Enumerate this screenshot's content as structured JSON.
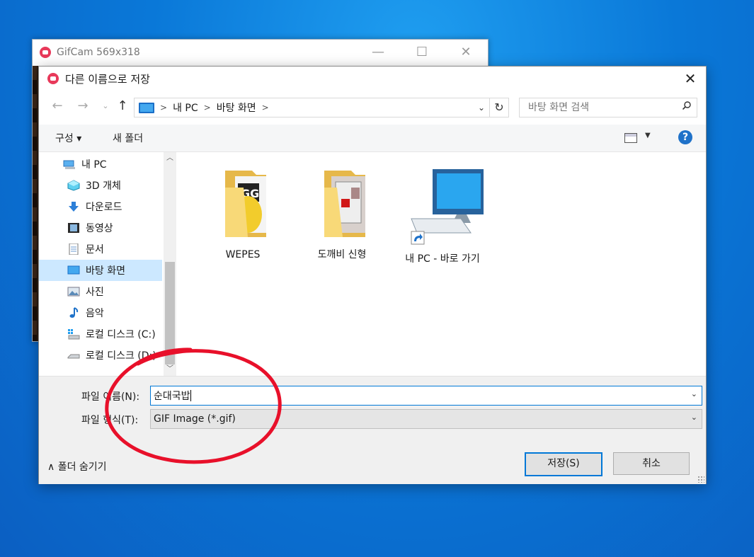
{
  "gifcam": {
    "title": "GifCam 569x318"
  },
  "dialog": {
    "title": "다른 이름으로 저장",
    "close": "✕",
    "address": {
      "segments": [
        "내 PC",
        "바탕 화면"
      ]
    },
    "search": {
      "placeholder": "바탕 화면 검색"
    },
    "toolbar": {
      "organize": "구성 ▾",
      "new_folder": "새 폴더",
      "help": "?"
    },
    "sidebar": {
      "items": [
        {
          "label": "내 PC",
          "icon": "pc-icon"
        },
        {
          "label": "3D 개체",
          "icon": "cube-icon"
        },
        {
          "label": "다운로드",
          "icon": "download-icon"
        },
        {
          "label": "동영상",
          "icon": "video-icon"
        },
        {
          "label": "문서",
          "icon": "document-icon"
        },
        {
          "label": "바탕 화면",
          "icon": "desktop-icon",
          "selected": true
        },
        {
          "label": "사진",
          "icon": "picture-icon"
        },
        {
          "label": "음악",
          "icon": "music-icon"
        },
        {
          "label": "로컬 디스크 (C:)",
          "icon": "drive-c-icon"
        },
        {
          "label": "로컬 디스크 (D:)",
          "icon": "drive-d-icon"
        }
      ]
    },
    "files": [
      {
        "name": "WEPES",
        "icon": "folder-icon"
      },
      {
        "name": "도깨비 신형",
        "icon": "folder-icon"
      },
      {
        "name": "내 PC - 바로 가기",
        "icon": "pc-shortcut-icon"
      }
    ],
    "filename": {
      "label": "파일 이름(N):",
      "value": "순대국밥"
    },
    "filetype": {
      "label": "파일 형식(T):",
      "value": "GIF Image (*.gif)"
    },
    "hide_folders": "∧  폴더 숨기기",
    "save_button": "저장(S)",
    "cancel_button": "취소"
  },
  "colors": {
    "annotation": "#e8102a",
    "accent": "#0078d7",
    "selected_bg": "#cce8ff"
  }
}
